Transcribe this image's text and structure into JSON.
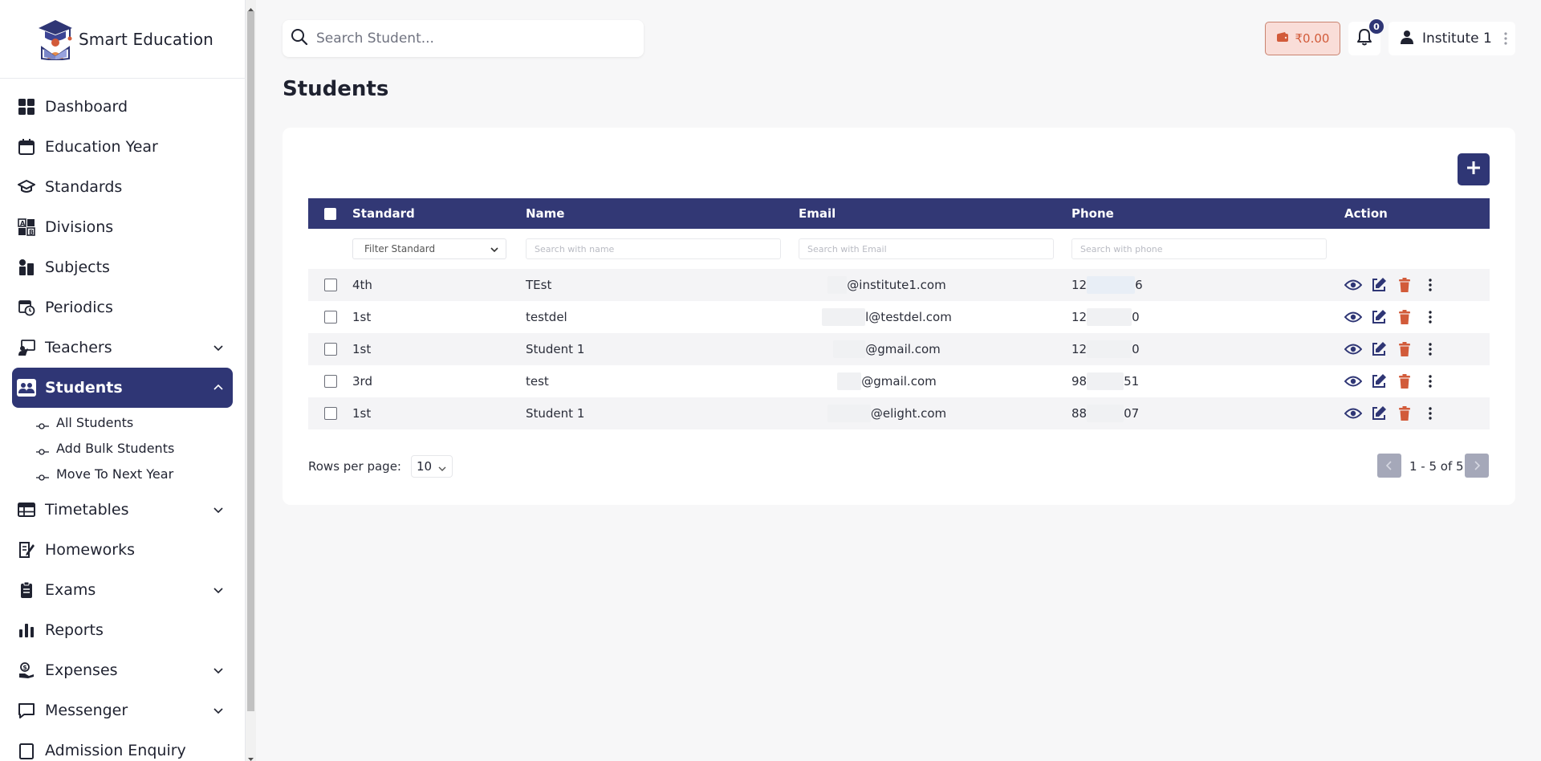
{
  "app": {
    "name": "Smart Education"
  },
  "sidebar": {
    "items": [
      {
        "label": "Dashboard",
        "icon": "dashboard-icon",
        "has_chevron": false
      },
      {
        "label": "Education Year",
        "icon": "calendar-icon",
        "has_chevron": false
      },
      {
        "label": "Standards",
        "icon": "graduation-cap-icon",
        "has_chevron": false
      },
      {
        "label": "Divisions",
        "icon": "divisions-icon",
        "has_chevron": false
      },
      {
        "label": "Subjects",
        "icon": "subjects-icon",
        "has_chevron": false
      },
      {
        "label": "Periodics",
        "icon": "periodics-icon",
        "has_chevron": false
      },
      {
        "label": "Teachers",
        "icon": "teacher-icon",
        "has_chevron": true
      },
      {
        "label": "Students",
        "icon": "students-icon",
        "has_chevron": true,
        "active": true
      },
      {
        "label": "Timetables",
        "icon": "timetable-icon",
        "has_chevron": true
      },
      {
        "label": "Homeworks",
        "icon": "homework-icon",
        "has_chevron": false
      },
      {
        "label": "Exams",
        "icon": "exam-icon",
        "has_chevron": true
      },
      {
        "label": "Reports",
        "icon": "reports-icon",
        "has_chevron": false
      },
      {
        "label": "Expenses",
        "icon": "expenses-icon",
        "has_chevron": true
      },
      {
        "label": "Messenger",
        "icon": "messenger-icon",
        "has_chevron": true
      },
      {
        "label": "Admission Enquiry",
        "icon": "admission-icon",
        "has_chevron": false
      }
    ],
    "students_sub": [
      "All Students",
      "Add Bulk Students",
      "Move To Next Year"
    ]
  },
  "topbar": {
    "search_placeholder": "Search Student...",
    "wallet_amount": "₹0.00",
    "notification_count": "0",
    "user_name": "Institute 1"
  },
  "page": {
    "title": "Students"
  },
  "table": {
    "columns": [
      "Standard",
      "Name",
      "Email",
      "Phone",
      "Action"
    ],
    "filters": {
      "standard": "Filter Standard",
      "name_placeholder": "Search with name",
      "email_placeholder": "Search with Email",
      "phone_placeholder": "Search with phone"
    },
    "rows": [
      {
        "standard": "4th",
        "name": "TEst",
        "email": "@institute1.com",
        "phone_start": "12",
        "phone_end": "6"
      },
      {
        "standard": "1st",
        "name": "testdel",
        "email": "l@testdel.com",
        "phone_start": "12",
        "phone_end": "0"
      },
      {
        "standard": "1st",
        "name": "Student 1",
        "email": "@gmail.com",
        "phone_start": "12",
        "phone_end": "0"
      },
      {
        "standard": "3rd",
        "name": "test",
        "email": "@gmail.com",
        "phone_start": "98",
        "phone_end": "51"
      },
      {
        "standard": "1st",
        "name": "Student 1",
        "email": "@elight.com",
        "phone_start": "88",
        "phone_end": "07"
      }
    ]
  },
  "pagination": {
    "rows_per_page_label": "Rows per page:",
    "rows_per_page": "10",
    "range": "1 - 5 of 5"
  },
  "colors": {
    "primary": "#2f3675",
    "delete": "#d25b3a",
    "wallet_bg": "#f9ddd8"
  }
}
